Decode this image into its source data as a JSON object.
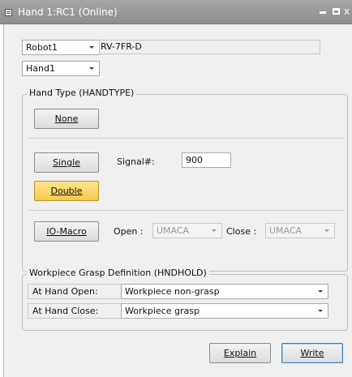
{
  "window": {
    "title": "Hand 1:RC1 (Online)",
    "close_glyph": "x"
  },
  "robot_select": {
    "value": "Robot1"
  },
  "robot_model": "RV-7FR-D",
  "hand_select": {
    "value": "Hand1"
  },
  "hand_type_group": {
    "label": "Hand Type (HANDTYPE)",
    "none_label": "None",
    "single_label": "Single",
    "signal_label": "Signal#:",
    "signal_value": "900",
    "double_label": "Double",
    "io_macro_label": "IO-Macro",
    "open_label": "Open :",
    "open_value": "UMACA",
    "close_label": "Close :",
    "close_value": "UMACA",
    "selected": "Double"
  },
  "grasp_group": {
    "label": "Workpiece Grasp Definition (HNDHOLD)",
    "rows": [
      {
        "label": "At Hand Open:",
        "value": "Workpiece non-grasp"
      },
      {
        "label": "At Hand Close:",
        "value": "Workpiece grasp"
      }
    ]
  },
  "footer": {
    "explain_label": "Explain",
    "write_label": "Write"
  },
  "colors": {
    "selected_button": "#f6c94c",
    "titlebar": "#9a9a9a"
  }
}
